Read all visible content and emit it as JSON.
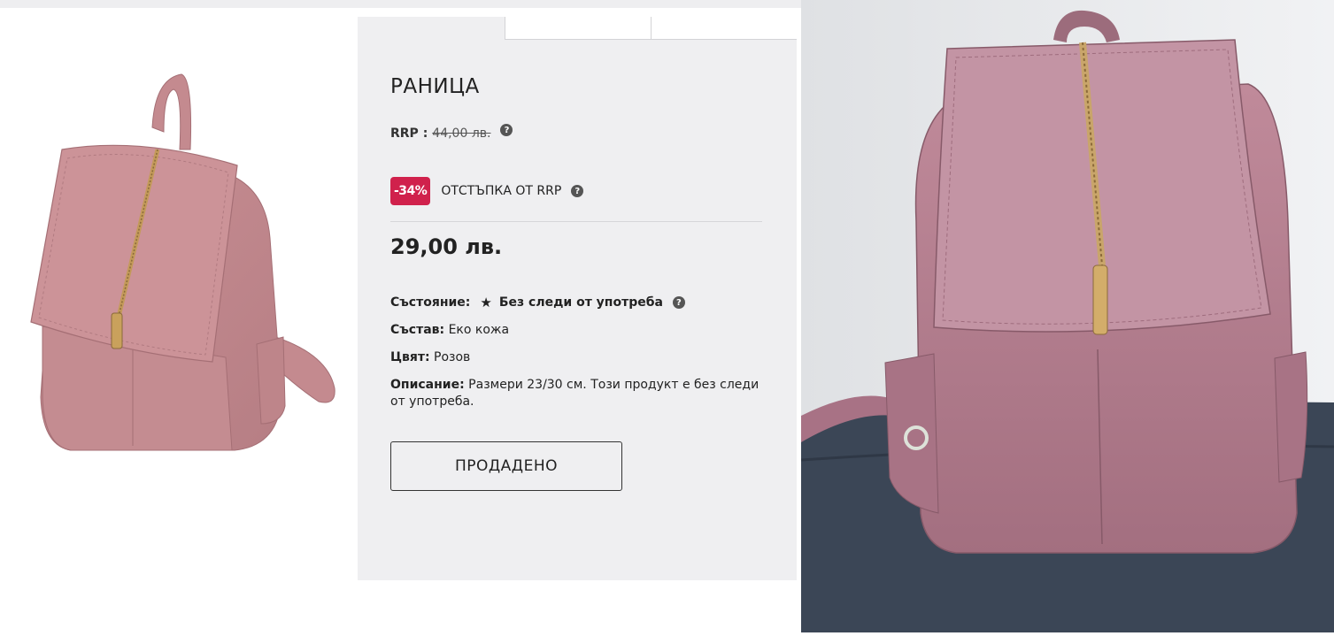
{
  "product": {
    "title": "РАНИЦА",
    "rrp_label": "RRP :",
    "rrp_price": "44,00 лв.",
    "discount_badge": "-34%",
    "discount_label": "ОТСТЪПКА ОТ RRP",
    "price": "29,00 лв.",
    "help_glyph": "?",
    "state_label": "Състояние:",
    "state_icon": "star-icon",
    "state_value": "Без следи от употреба",
    "composition_label": "Състав:",
    "composition_value": "Еко кожа",
    "color_label": "Цвят:",
    "color_value": "Розов",
    "description_label": "Описание:",
    "description_value": "Размери 23/30 см. Този продукт е без следи от употреба.",
    "sold_button": "ПРОДАДЕНО"
  },
  "colors": {
    "panel_bg": "#efeff1",
    "badge_bg": "#d0214c",
    "bag_pink": "#c28a8f"
  }
}
